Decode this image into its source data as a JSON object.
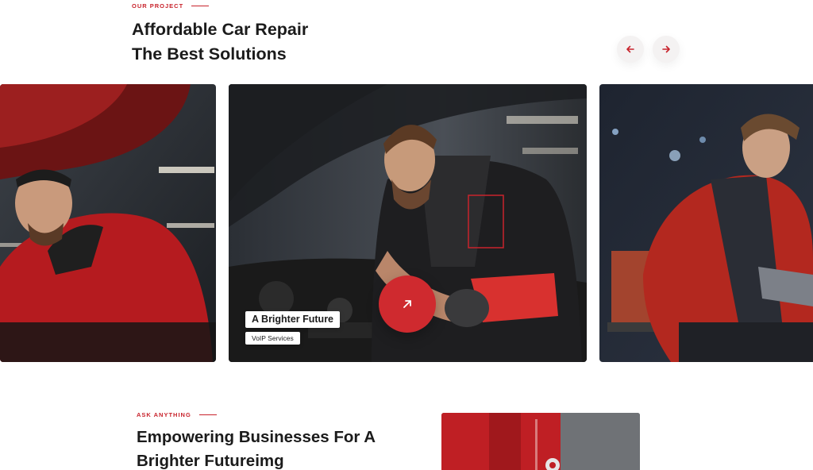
{
  "project": {
    "eyebrow": "OUR PROJECT",
    "title_line1": "Affordable Car Repair",
    "title_line2": "The Best Solutions",
    "prev_icon": "arrow-left-icon",
    "next_icon": "arrow-right-icon"
  },
  "cards": [
    {
      "image": "mechanic-red-jacket-left-photo"
    },
    {
      "image": "mechanic-engine-bay-photo",
      "title": "A Brighter Future",
      "subtitle": "VoIP Services",
      "action_icon": "arrow-up-right-icon"
    },
    {
      "image": "mechanic-kneeling-photo"
    }
  ],
  "faq": {
    "eyebrow": "ASK ANYTHING",
    "title_line1": "Empowering Businesses For A",
    "title_line2": "Brighter Futureimg",
    "image": "mechanic-with-wrench-photo"
  },
  "colors": {
    "accent": "#c8232c",
    "heading": "#1b1b1b",
    "nav_button_bg": "#f4f2f2",
    "chip_bg": "#ffffff"
  }
}
